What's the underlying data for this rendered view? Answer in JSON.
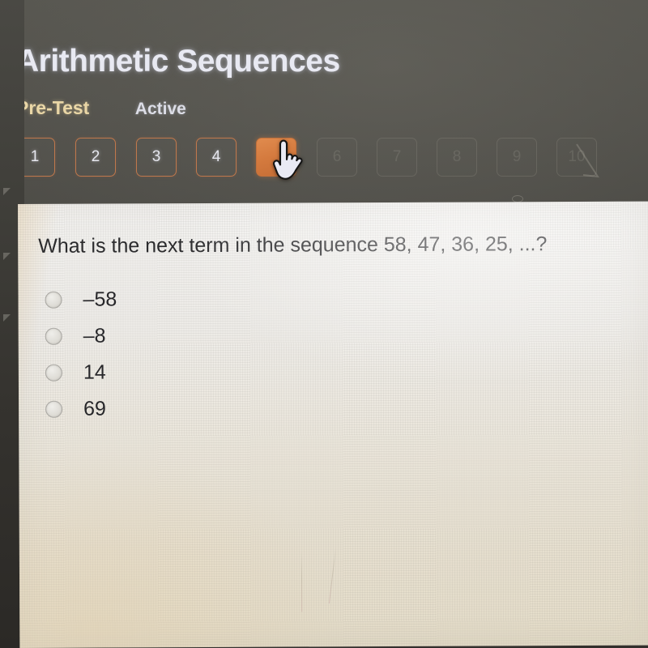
{
  "header": {
    "title": "Arithmetic Sequences",
    "test_label": "Pre-Test",
    "status_label": "Active"
  },
  "pagination": {
    "current_page": 5,
    "items": [
      {
        "label": "1",
        "state": "available"
      },
      {
        "label": "2",
        "state": "available"
      },
      {
        "label": "3",
        "state": "available"
      },
      {
        "label": "4",
        "state": "available"
      },
      {
        "label": "5",
        "state": "current"
      },
      {
        "label": "6",
        "state": "locked"
      },
      {
        "label": "7",
        "state": "locked"
      },
      {
        "label": "8",
        "state": "locked"
      },
      {
        "label": "9",
        "state": "locked"
      },
      {
        "label": "10",
        "state": "locked"
      }
    ]
  },
  "question": {
    "prompt": "What is the next term in the sequence 58, 47, 36, 25, ...?",
    "selected_option": null,
    "options": [
      {
        "label": "–58",
        "selected": false
      },
      {
        "label": "–8",
        "selected": false
      },
      {
        "label": "14",
        "selected": false
      },
      {
        "label": "69",
        "selected": false
      }
    ]
  },
  "cursor": {
    "icon": "pointing-hand-cursor",
    "over_element": "page-button-5"
  },
  "colors": {
    "accent_orange": "#d47a3e",
    "outline_orange": "#c0784c",
    "title_text": "#e8e9f2",
    "pretest_text": "#e9d6a6",
    "dark_background": "#4a4944",
    "panel_background": "#eeece8",
    "question_text": "#2b2b2d"
  }
}
